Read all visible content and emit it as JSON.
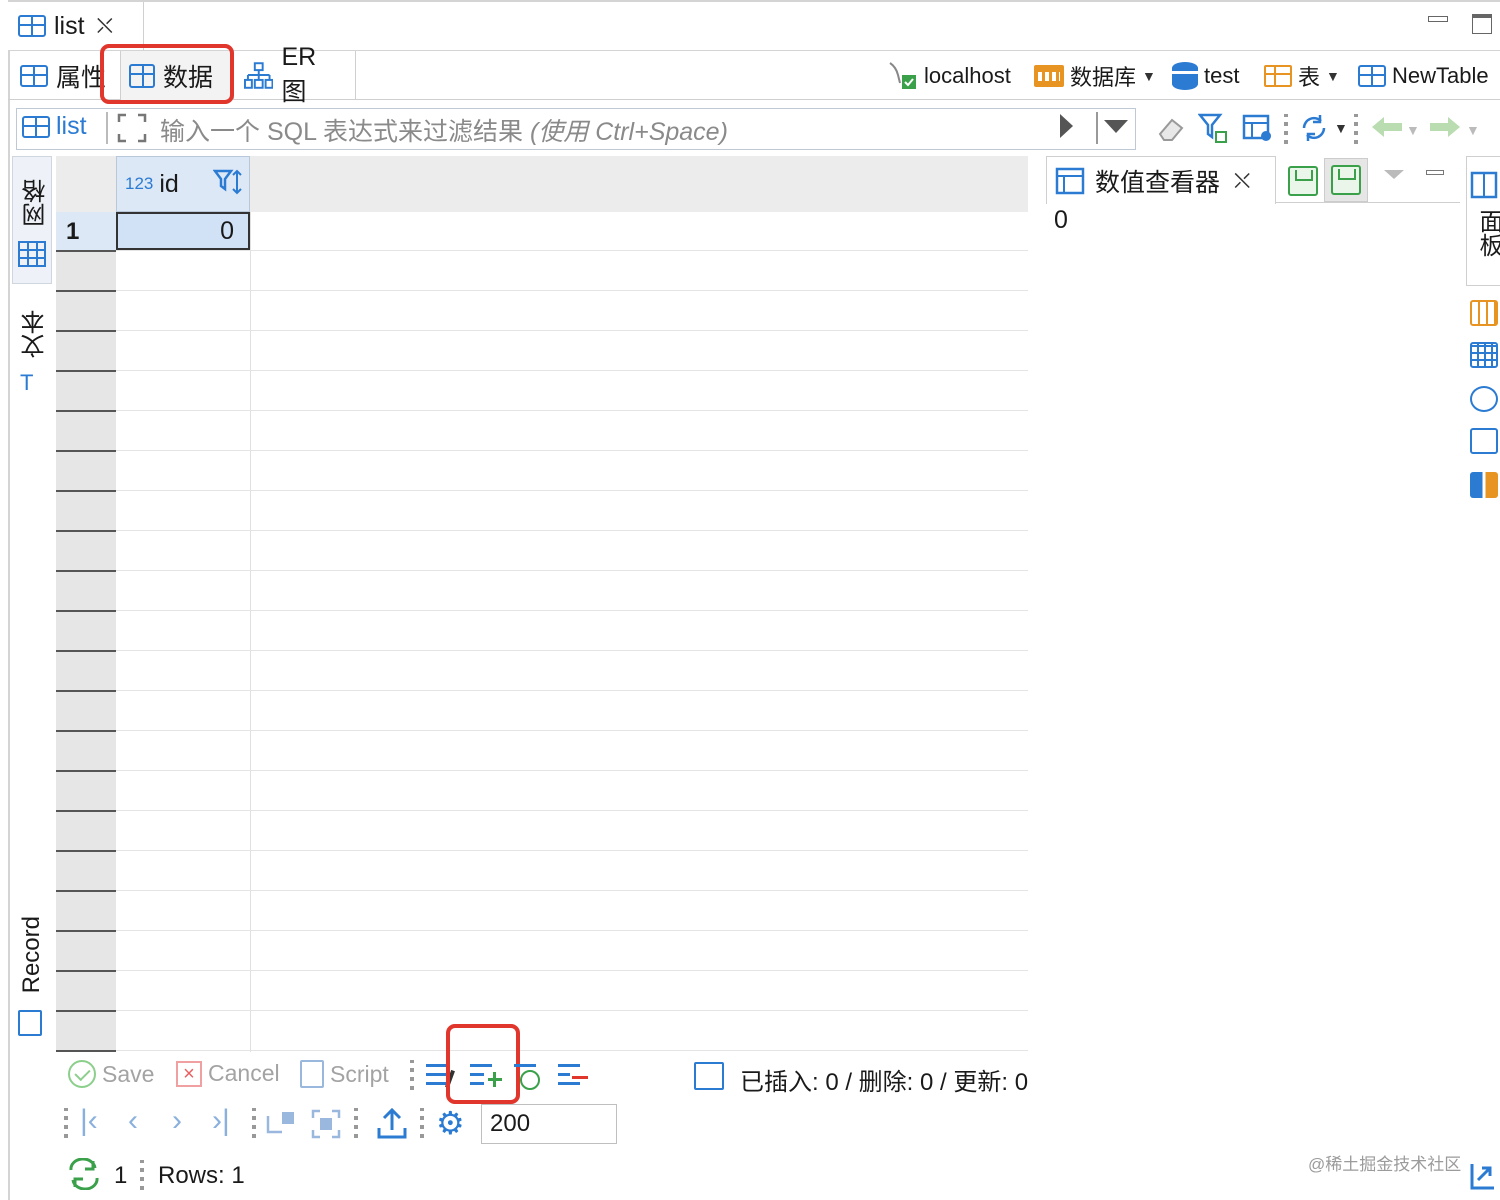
{
  "editor_tab": {
    "title": "list"
  },
  "subtabs": [
    {
      "label": "属性"
    },
    {
      "label": "数据"
    },
    {
      "label": "ER 图"
    }
  ],
  "breadcrumbs": {
    "connection": "localhost",
    "database": "数据库",
    "schema": "test",
    "table": "表",
    "entity": "NewTable"
  },
  "filter": {
    "label": "list",
    "placeholder_a": "输入一个 SQL 表达式来过滤结果 ",
    "placeholder_b": "(使用 Ctrl+Space)"
  },
  "grid": {
    "column_type": "123",
    "columns": [
      {
        "name": "id"
      }
    ],
    "rows": [
      {
        "num": "1",
        "values": [
          "0"
        ]
      }
    ]
  },
  "left_panel_tabs": {
    "grid": "网格",
    "text": "文本",
    "record": "Record"
  },
  "value_viewer": {
    "title": "数值查看器",
    "value": "0"
  },
  "right_panel_tab": {
    "label": "面板"
  },
  "bottom_toolbar": {
    "save": "Save",
    "cancel": "Cancel",
    "script": "Script",
    "stats": "已插入: 0 / 删除: 0 / 更新: 0",
    "fetch_size": "200",
    "refresh_count": "1",
    "rows": "Rows: 1"
  },
  "watermark": "@稀土掘金技术社区",
  "colors": {
    "accent": "#2b7bd3",
    "highlight": "#e0362c",
    "selection": "#d2e2f6"
  }
}
